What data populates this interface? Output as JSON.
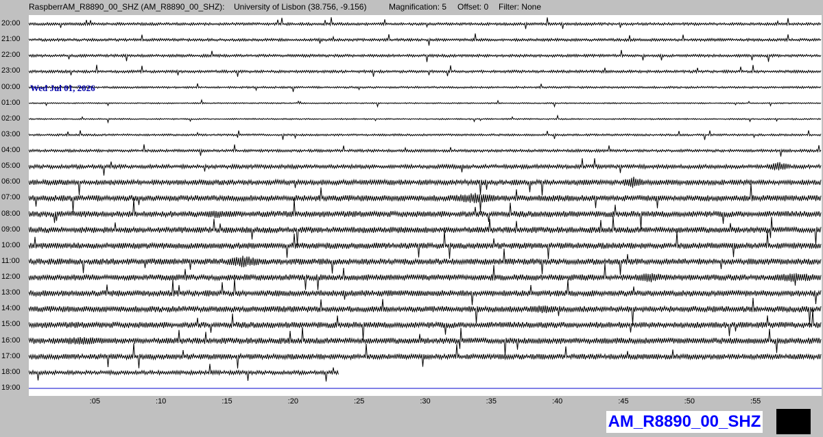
{
  "header": {
    "station": "RaspberrAM_R8890_00_SHZ (AM_R8890_00_SHZ):",
    "location": "University of Lisbon (38.756, -9.156)",
    "magnification": "Magnification: 5",
    "offset": "Offset: 0",
    "filter": "Filter: None"
  },
  "date_label": "Wed Jul 01, 2026",
  "station_label": "AM_R8890_00_SHZ",
  "chart_data": {
    "type": "line",
    "title": "",
    "hour_labels": [
      "20:00",
      "21:00",
      "22:00",
      "23:00",
      "00:00",
      "01:00",
      "02:00",
      "03:00",
      "04:00",
      "05:00",
      "06:00",
      "07:00",
      "08:00",
      "09:00",
      "10:00",
      "11:00",
      "12:00",
      "13:00",
      "14:00",
      "15:00",
      "16:00",
      "17:00",
      "18:00",
      "19:00"
    ],
    "minute_ticks": [
      ":05",
      ":10",
      ":15",
      ":20",
      ":25",
      ":30",
      ":35",
      ":40",
      ":45",
      ":50",
      ":55"
    ],
    "minute_tick_values": [
      5,
      10,
      15,
      20,
      25,
      30,
      35,
      40,
      45,
      50,
      55
    ],
    "xlim": [
      0,
      60
    ],
    "noise_amplitude": [
      2,
      2,
      2,
      2,
      1.5,
      1,
      1,
      1.5,
      2,
      3,
      4,
      4.5,
      4.5,
      4.5,
      4.5,
      4.5,
      4.5,
      4.5,
      4.5,
      4.5,
      4.5,
      4,
      3,
      0
    ],
    "trace_end_minute": [
      60,
      60,
      60,
      60,
      60,
      60,
      60,
      60,
      60,
      60,
      60,
      60,
      60,
      60,
      60,
      60,
      60,
      60,
      60,
      60,
      60,
      60,
      23.5,
      0
    ],
    "trace_color": "#000000",
    "current_line_color": "#0000cc",
    "events": [
      {
        "hour": "14:00",
        "start_minute": 37.5,
        "end_minute": 40.5,
        "amplitude": 6
      },
      {
        "hour": "11:00",
        "start_minute": 15,
        "end_minute": 17.5,
        "amplitude": 9
      },
      {
        "hour": "07:00",
        "start_minute": 32,
        "end_minute": 35.5,
        "amplitude": 8
      },
      {
        "hour": "16:00",
        "start_minute": 1.5,
        "end_minute": 6.5,
        "amplitude": 6
      },
      {
        "hour": "12:00",
        "start_minute": 46,
        "end_minute": 48,
        "amplitude": 8
      },
      {
        "hour": "12:00",
        "start_minute": 56,
        "end_minute": 60,
        "amplitude": 7
      },
      {
        "hour": "08:00",
        "start_minute": 13,
        "end_minute": 15.5,
        "amplitude": 6
      },
      {
        "hour": "06:00",
        "start_minute": 45,
        "end_minute": 46.5,
        "amplitude": 9
      },
      {
        "hour": "05:00",
        "start_minute": 56,
        "end_minute": 57.5,
        "amplitude": 7
      }
    ]
  }
}
